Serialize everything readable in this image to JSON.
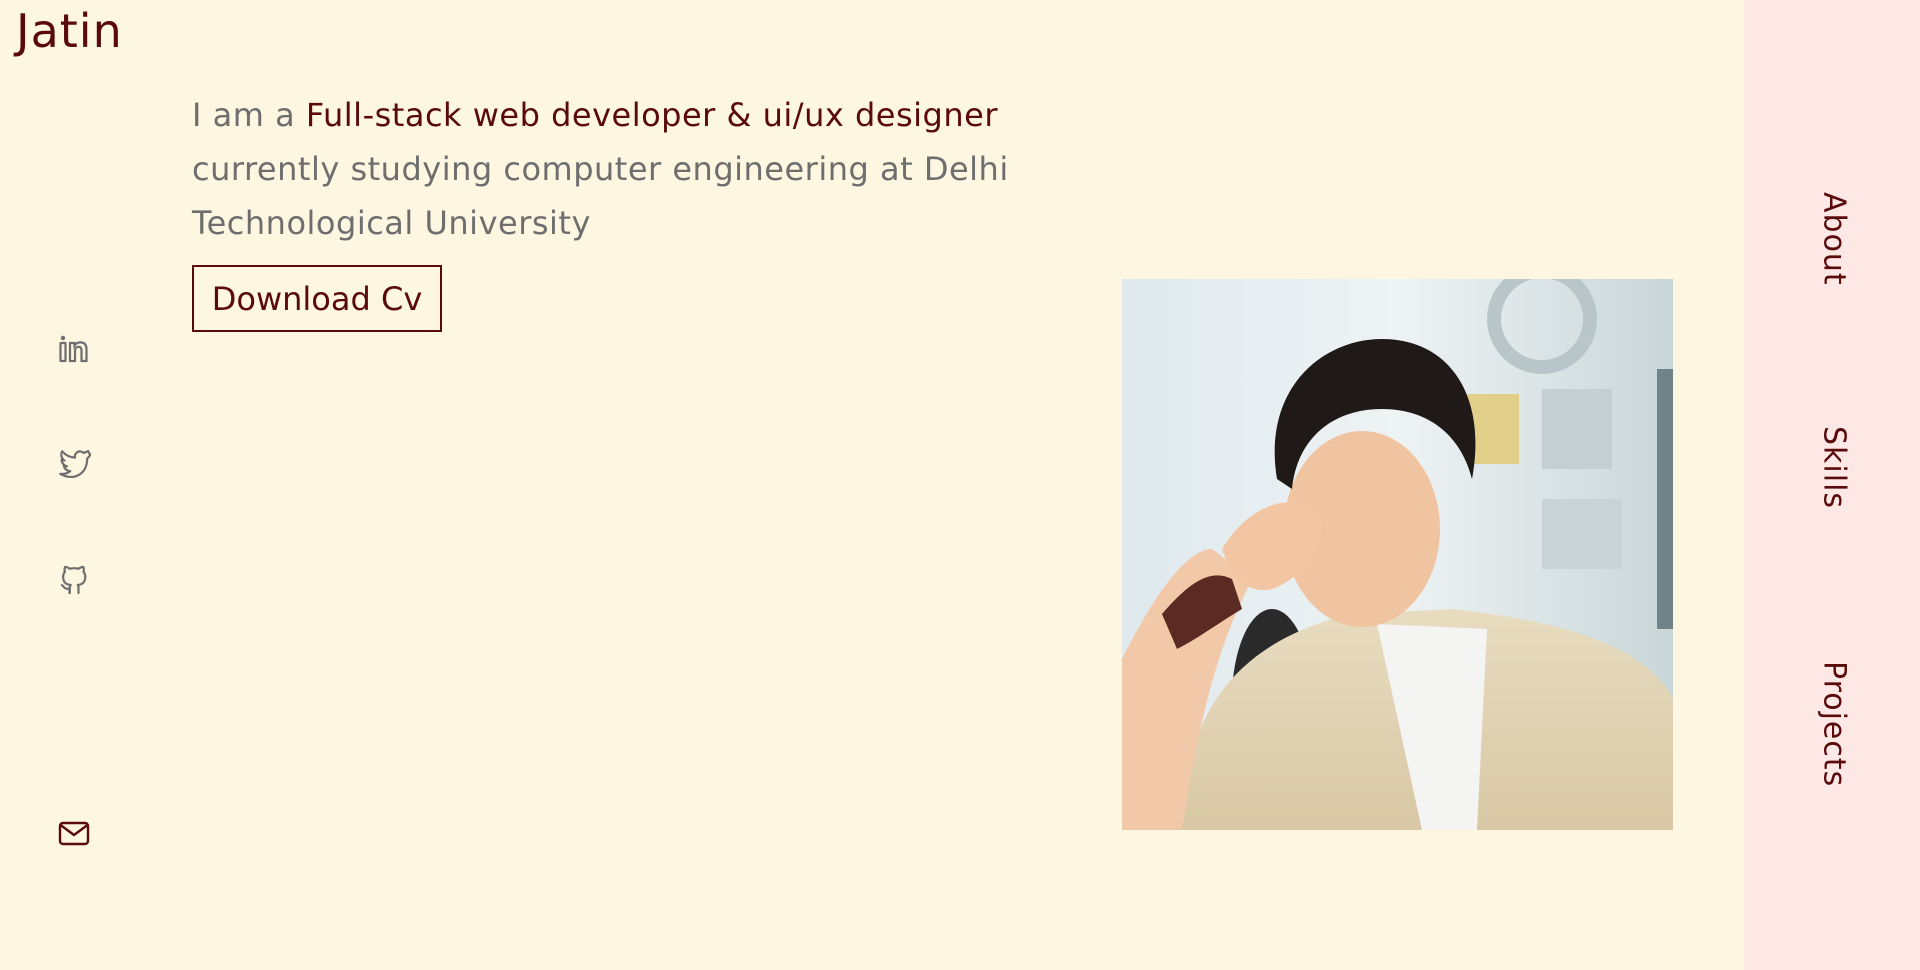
{
  "header": {
    "logo": "Jatin"
  },
  "intro": {
    "prefix": "I am a ",
    "highlight": "Full-stack web developer & ui/ux designer",
    "suffix": " currently studying computer engineering at Delhi Technological University"
  },
  "cv_button": {
    "label": "Download Cv"
  },
  "social": {
    "icons": [
      "linkedin-icon",
      "twitter-icon",
      "github-icon",
      "mail-icon"
    ]
  },
  "nav": {
    "items": [
      {
        "label": "About"
      },
      {
        "label": "Skills"
      },
      {
        "label": "Projects"
      }
    ]
  },
  "colors": {
    "background": "#fdf6e1",
    "accent": "#5a0a0a",
    "muted_text": "#6e6e6e",
    "side_nav_bg": "#fde8e6"
  }
}
